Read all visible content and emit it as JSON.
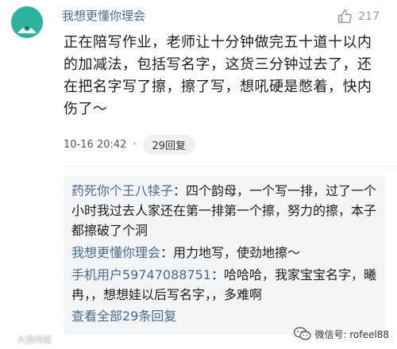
{
  "comment": {
    "username": "我想更懂你理会",
    "likes": "217",
    "text": "正在陪写作业，老师让十分钟做完五十道十以内的加减法，包括写名字，这货三分钟过去了，还在把名字写了擦，擦了写，想吼硬是憋着，快内伤了～",
    "timestamp": "10-16 20:42",
    "dot": "·",
    "reply_button": "29回复"
  },
  "replies": [
    {
      "name": "药死你个王八犊子",
      "sep": "：",
      "text": "四个韵母，一个写一排，过了一个小时我过去人家还在第一排第一个擦，努力的擦，本子都擦破了个洞"
    },
    {
      "name": "我想更懂你理会",
      "sep": "：",
      "text": "用力地写，使劲地擦～"
    },
    {
      "name": "手机用户59747088751",
      "sep": "：",
      "text": "哈哈哈，我家宝宝名字，曦冉，，想想娃以后写名字，，多难啊"
    }
  ],
  "view_all": "查看全部29条回复",
  "watermark_left": "大西传媒",
  "watermark_right": "微信号: rofeel88",
  "colors": {
    "link": "#4a6a8f",
    "avatar": "#2bb3a0",
    "reply_bg": "#f4f5f7"
  }
}
